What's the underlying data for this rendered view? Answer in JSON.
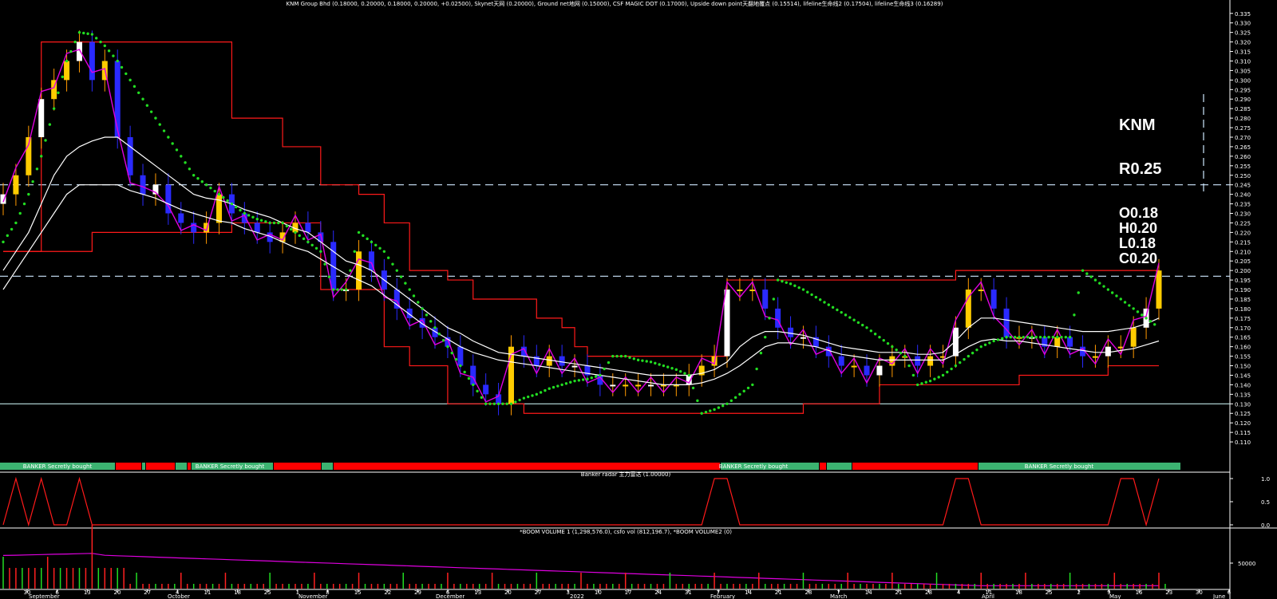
{
  "header": {
    "title": "KNM Group Bhd (0.18000, 0.20000, 0.18000, 0.20000, +0.02500), Skynet天网 (0.20000), Ground net地网 (0.15000), CSF MAGIC DOT (0.17000), Upside down point天翻地覆点 (0.15514), lifeline生命线2 (0.17504), lifeline生命线3 (0.16289)"
  },
  "overlay": {
    "ticker": "KNM",
    "resistance": "R0.25",
    "open": "O0.18",
    "high": "H0.20",
    "low": "L0.18",
    "close": "C0.20"
  },
  "banker_banner": {
    "label": "BANKER Secretly bought",
    "colors": {
      "bought": "#3cb371",
      "other": "#ff0000"
    }
  },
  "radar_panel": {
    "title": "Banker radar 主力雷达 (1.00000)",
    "ticks": [
      "1.0",
      "0.5",
      "0.0"
    ]
  },
  "volume_panel": {
    "title": "*BOOM VOLUME 1 (1,298,576.0), csfo vol (812,196.7), *BOOM VOLUME2 (0)",
    "ticks": [
      "50000"
    ]
  },
  "x_axis": {
    "day_labels": [
      "30",
      "6",
      "13",
      "20",
      "27",
      "4",
      "11",
      "18",
      "25",
      "1",
      "8",
      "15",
      "22",
      "29",
      "6",
      "13",
      "20",
      "27",
      "3",
      "10",
      "17",
      "24",
      "31",
      "7",
      "14",
      "21",
      "28",
      "7",
      "14",
      "21",
      "28",
      "4",
      "11",
      "18",
      "25",
      "2",
      "9",
      "16",
      "23",
      "30",
      "6"
    ],
    "month_labels": [
      "September",
      "October",
      "November",
      "December",
      "2022",
      "February",
      "March",
      "April",
      "May",
      "June"
    ]
  },
  "y_axis": {
    "ticks": [
      "0.335",
      "0.330",
      "0.325",
      "0.320",
      "0.315",
      "0.310",
      "0.305",
      "0.300",
      "0.295",
      "0.290",
      "0.285",
      "0.280",
      "0.275",
      "0.270",
      "0.265",
      "0.260",
      "0.255",
      "0.250",
      "0.245",
      "0.240",
      "0.235",
      "0.230",
      "0.225",
      "0.220",
      "0.215",
      "0.210",
      "0.205",
      "0.200",
      "0.195",
      "0.190",
      "0.185",
      "0.180",
      "0.175",
      "0.170",
      "0.165",
      "0.160",
      "0.155",
      "0.150",
      "0.145",
      "0.140",
      "0.135",
      "0.130",
      "0.125",
      "0.120",
      "0.115",
      "0.110"
    ]
  },
  "chart_data": {
    "type": "line",
    "title": "KNM Group Bhd",
    "ylim": [
      0.105,
      0.337
    ],
    "reference_lines": [
      0.245,
      0.197,
      0.13
    ],
    "price_close": [
      0.24,
      0.25,
      0.27,
      0.29,
      0.3,
      0.31,
      0.32,
      0.3,
      0.31,
      0.27,
      0.25,
      0.24,
      0.245,
      0.23,
      0.225,
      0.22,
      0.225,
      0.24,
      0.23,
      0.225,
      0.22,
      0.215,
      0.22,
      0.225,
      0.22,
      0.215,
      0.19,
      0.19,
      0.21,
      0.2,
      0.19,
      0.18,
      0.175,
      0.17,
      0.165,
      0.16,
      0.15,
      0.14,
      0.135,
      0.13,
      0.16,
      0.155,
      0.15,
      0.155,
      0.15,
      0.15,
      0.145,
      0.14,
      0.14,
      0.14,
      0.14,
      0.14,
      0.14,
      0.14,
      0.145,
      0.15,
      0.155,
      0.19,
      0.19,
      0.19,
      0.18,
      0.17,
      0.165,
      0.165,
      0.16,
      0.155,
      0.15,
      0.15,
      0.145,
      0.15,
      0.155,
      0.155,
      0.15,
      0.155,
      0.155,
      0.17,
      0.19,
      0.19,
      0.18,
      0.165,
      0.165,
      0.165,
      0.16,
      0.165,
      0.16,
      0.155,
      0.155,
      0.16,
      0.16,
      0.17,
      0.18,
      0.2
    ],
    "skynet": [
      0.21,
      0.21,
      0.21,
      0.32,
      0.32,
      0.32,
      0.32,
      0.32,
      0.32,
      0.32,
      0.32,
      0.32,
      0.32,
      0.32,
      0.32,
      0.32,
      0.32,
      0.32,
      0.28,
      0.28,
      0.28,
      0.28,
      0.265,
      0.265,
      0.265,
      0.245,
      0.245,
      0.245,
      0.24,
      0.24,
      0.225,
      0.225,
      0.2,
      0.2,
      0.2,
      0.195,
      0.195,
      0.185,
      0.185,
      0.185,
      0.185,
      0.185,
      0.175,
      0.175,
      0.17,
      0.16,
      0.155,
      0.155,
      0.155,
      0.155,
      0.155,
      0.155,
      0.155,
      0.155,
      0.155,
      0.155,
      0.155,
      0.195,
      0.195,
      0.195,
      0.195,
      0.195,
      0.195,
      0.195,
      0.195,
      0.195,
      0.195,
      0.195,
      0.195,
      0.195,
      0.195,
      0.195,
      0.195,
      0.195,
      0.195,
      0.2,
      0.2,
      0.2,
      0.2,
      0.2,
      0.2,
      0.2,
      0.2,
      0.2,
      0.2,
      0.2,
      0.2,
      0.2,
      0.2,
      0.2,
      0.2,
      0.2
    ],
    "groundnet": [
      0.21,
      0.21,
      0.21,
      0.21,
      0.21,
      0.21,
      0.21,
      0.22,
      0.22,
      0.22,
      0.22,
      0.22,
      0.22,
      0.22,
      0.22,
      0.22,
      0.22,
      0.22,
      0.225,
      0.225,
      0.225,
      0.225,
      0.225,
      0.225,
      0.225,
      0.19,
      0.19,
      0.19,
      0.19,
      0.19,
      0.16,
      0.16,
      0.15,
      0.15,
      0.15,
      0.13,
      0.13,
      0.13,
      0.13,
      0.13,
      0.13,
      0.125,
      0.125,
      0.125,
      0.125,
      0.125,
      0.125,
      0.125,
      0.125,
      0.125,
      0.125,
      0.125,
      0.125,
      0.125,
      0.125,
      0.125,
      0.125,
      0.125,
      0.125,
      0.125,
      0.125,
      0.125,
      0.125,
      0.13,
      0.13,
      0.13,
      0.13,
      0.13,
      0.13,
      0.14,
      0.14,
      0.14,
      0.14,
      0.14,
      0.14,
      0.14,
      0.14,
      0.14,
      0.14,
      0.14,
      0.145,
      0.145,
      0.145,
      0.145,
      0.145,
      0.145,
      0.145,
      0.15,
      0.15,
      0.15,
      0.15,
      0.15
    ],
    "lifeline2": [
      0.2,
      0.21,
      0.22,
      0.235,
      0.25,
      0.26,
      0.265,
      0.268,
      0.27,
      0.27,
      0.265,
      0.26,
      0.255,
      0.25,
      0.245,
      0.24,
      0.238,
      0.237,
      0.235,
      0.232,
      0.23,
      0.228,
      0.225,
      0.222,
      0.22,
      0.215,
      0.21,
      0.205,
      0.203,
      0.2,
      0.195,
      0.19,
      0.185,
      0.18,
      0.175,
      0.17,
      0.167,
      0.163,
      0.16,
      0.157,
      0.156,
      0.155,
      0.154,
      0.153,
      0.152,
      0.151,
      0.15,
      0.149,
      0.148,
      0.147,
      0.146,
      0.145,
      0.145,
      0.145,
      0.145,
      0.146,
      0.148,
      0.152,
      0.16,
      0.165,
      0.168,
      0.168,
      0.167,
      0.166,
      0.164,
      0.162,
      0.16,
      0.159,
      0.158,
      0.157,
      0.157,
      0.157,
      0.156,
      0.156,
      0.157,
      0.163,
      0.17,
      0.175,
      0.175,
      0.174,
      0.173,
      0.172,
      0.171,
      0.17,
      0.169,
      0.168,
      0.168,
      0.168,
      0.169,
      0.17,
      0.172,
      0.175
    ],
    "lifeline3": [
      0.19,
      0.2,
      0.21,
      0.22,
      0.23,
      0.24,
      0.245,
      0.245,
      0.245,
      0.245,
      0.242,
      0.24,
      0.238,
      0.235,
      0.232,
      0.23,
      0.228,
      0.226,
      0.225,
      0.222,
      0.22,
      0.218,
      0.215,
      0.212,
      0.21,
      0.206,
      0.202,
      0.198,
      0.195,
      0.192,
      0.187,
      0.182,
      0.177,
      0.172,
      0.168,
      0.164,
      0.16,
      0.157,
      0.155,
      0.153,
      0.152,
      0.151,
      0.15,
      0.149,
      0.148,
      0.147,
      0.146,
      0.145,
      0.144,
      0.143,
      0.142,
      0.141,
      0.14,
      0.14,
      0.14,
      0.141,
      0.143,
      0.146,
      0.15,
      0.155,
      0.16,
      0.162,
      0.162,
      0.161,
      0.16,
      0.158,
      0.156,
      0.155,
      0.154,
      0.153,
      0.153,
      0.153,
      0.153,
      0.153,
      0.153,
      0.156,
      0.16,
      0.163,
      0.164,
      0.163,
      0.163,
      0.162,
      0.161,
      0.16,
      0.159,
      0.158,
      0.157,
      0.157,
      0.158,
      0.159,
      0.161,
      0.163
    ],
    "magic_dot": [
      0.215,
      0.225,
      0.24,
      0.26,
      0.285,
      0.31,
      0.325,
      0.324,
      0.318,
      0.31,
      0.3,
      0.29,
      0.28,
      0.27,
      0.26,
      0.25,
      0.245,
      0.24,
      0.235,
      0.23,
      0.227,
      0.225,
      0.225,
      0.22,
      0.215,
      0.21,
      0.19,
      0.19,
      0.22,
      0.215,
      0.21,
      0.2,
      0.19,
      0.18,
      0.17,
      0.16,
      0.15,
      0.14,
      0.13,
      0.13,
      0.13,
      0.133,
      0.135,
      0.138,
      0.14,
      0.142,
      0.143,
      0.145,
      0.155,
      0.155,
      0.153,
      0.152,
      0.15,
      0.148,
      0.145,
      0.125,
      0.127,
      0.13,
      0.135,
      0.14,
      0.165,
      0.195,
      0.193,
      0.19,
      0.186,
      0.182,
      0.178,
      0.174,
      0.17,
      0.165,
      0.16,
      0.155,
      0.14,
      0.142,
      0.145,
      0.15,
      0.155,
      0.16,
      0.163,
      0.165,
      0.165,
      0.165,
      0.165,
      0.165,
      0.165,
      0.2,
      0.195,
      0.19,
      0.185,
      0.18,
      0.175,
      0.17
    ],
    "radar": [
      0,
      1,
      0,
      1,
      0,
      0,
      1,
      0,
      0,
      0,
      0,
      0,
      0,
      0,
      0,
      0,
      0,
      0,
      0,
      0,
      0,
      0,
      0,
      0,
      0,
      0,
      0,
      0,
      0,
      0,
      0,
      0,
      0,
      0,
      0,
      0,
      0,
      0,
      0,
      0,
      0,
      0,
      0,
      0,
      0,
      0,
      0,
      0,
      0,
      0,
      0,
      0,
      0,
      0,
      0,
      0,
      1,
      1,
      0,
      0,
      0,
      0,
      0,
      0,
      0,
      0,
      0,
      0,
      0,
      0,
      0,
      0,
      0,
      0,
      0,
      1,
      1,
      0,
      0,
      0,
      0,
      0,
      0,
      0,
      0,
      0,
      0,
      0,
      1,
      1,
      0,
      1
    ]
  }
}
